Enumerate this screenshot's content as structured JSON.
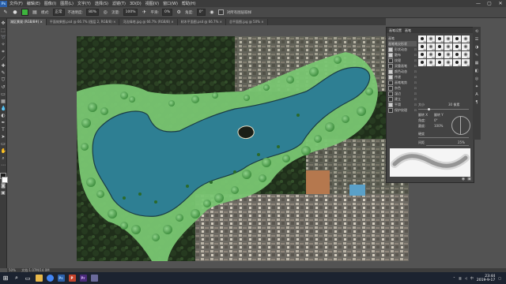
{
  "menubar": {
    "logo": "Ps",
    "items": [
      "文件(F)",
      "编辑(E)",
      "图像(I)",
      "图层(L)",
      "文字(Y)",
      "选择(S)",
      "滤镜(T)",
      "3D(D)",
      "视图(V)",
      "窗口(W)",
      "帮助(H)"
    ],
    "window_controls": [
      "—",
      "▢",
      "✕"
    ]
  },
  "options_bar": {
    "mode_label": "模式:",
    "mode_value": "正常",
    "opacity_label": "不透明度:",
    "opacity_value": "80%",
    "flow_label": "流量:",
    "flow_value": "100%",
    "smoothing_label": "平滑:",
    "smoothing_value": "0%",
    "angle_label": "角度:",
    "angle_value": "0°",
    "sample_label": "对所有图层取样"
  },
  "tabs": [
    {
      "label": "湖区景观 (RGB/8#) ×",
      "active": true
    },
    {
      "label": "平面效果图.psd @ 66.7% (图层 2, RGB/8) ×",
      "active": false
    },
    {
      "label": "河边绿地.jpg @ 66.7% (RGB/8) ×",
      "active": false
    },
    {
      "label": "树木平面图.psd @ 66.7% ×",
      "active": false
    },
    {
      "label": "总平面图.jpg @ 50% ×",
      "active": false
    }
  ],
  "brush_panel": {
    "tabs": [
      "画笔设置",
      "画笔"
    ],
    "options": [
      {
        "label": "画笔",
        "checked": false,
        "selected": false
      },
      {
        "label": "画笔笔尖形状",
        "checked": false,
        "selected": true
      },
      {
        "label": "形状动态",
        "checked": true,
        "selected": false
      },
      {
        "label": "散布",
        "checked": true,
        "selected": false
      },
      {
        "label": "纹理",
        "checked": false,
        "selected": false
      },
      {
        "label": "双重画笔",
        "checked": false,
        "selected": false
      },
      {
        "label": "颜色动态",
        "checked": true,
        "selected": false
      },
      {
        "label": "传递",
        "checked": true,
        "selected": false
      },
      {
        "label": "画笔笔势",
        "checked": false,
        "selected": false
      },
      {
        "label": "杂色",
        "checked": false,
        "selected": false
      },
      {
        "label": "湿边",
        "checked": false,
        "selected": false
      },
      {
        "label": "建立",
        "checked": false,
        "selected": false
      },
      {
        "label": "平滑",
        "checked": true,
        "selected": false
      },
      {
        "label": "保护纹理",
        "checked": false,
        "selected": false
      }
    ],
    "tip_sizes": [
      "30",
      "30",
      "30",
      "25",
      "25",
      "25",
      "36",
      "25",
      "36",
      "36",
      "36",
      "32",
      "25",
      "50",
      "71",
      "25",
      "50",
      "71",
      "25",
      "50",
      "71",
      "50",
      "50",
      "36"
    ],
    "size_label": "大小",
    "size_value": "30 像素",
    "flipx_label": "翻转 X",
    "flipy_label": "翻转 Y",
    "angle_label": "角度:",
    "angle_value": "0°",
    "roundness_label": "圆度:",
    "roundness_value": "100%",
    "hardness_label": "硬度",
    "spacing_label": "间距",
    "spacing_value": "25%"
  },
  "status": {
    "zoom": "50%",
    "doc": "文档:1.07M/14.0M"
  },
  "taskbar": {
    "apps": [
      {
        "name": "files",
        "label": "",
        "color": "#e8b84a"
      },
      {
        "name": "chrome",
        "label": "",
        "color": "#4285f4"
      },
      {
        "name": "photoshop",
        "label": "Ps",
        "color": "#2c5fa8"
      },
      {
        "name": "powerpoint",
        "label": "P",
        "color": "#c4432b"
      },
      {
        "name": "premiere",
        "label": "Pr",
        "color": "#4a2a7a"
      },
      {
        "name": "app6",
        "label": "",
        "color": "#6a6a9a"
      }
    ],
    "time": "23:44",
    "date": "2019-9-17",
    "tray_lang": "中"
  }
}
